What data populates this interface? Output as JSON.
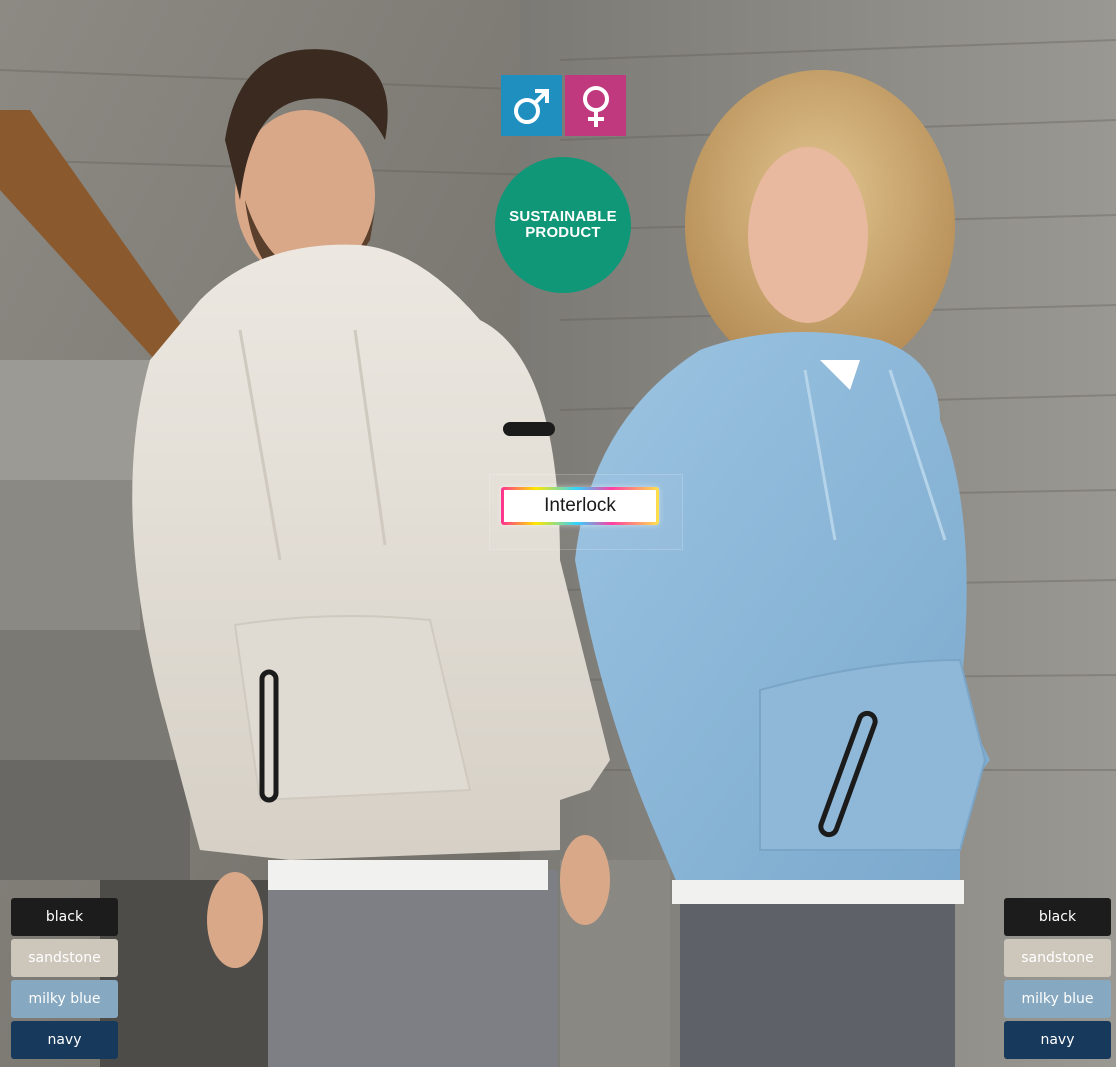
{
  "badges": {
    "male_icon": "male-symbol-icon",
    "female_icon": "female-symbol-icon",
    "sustainable_line1": "SUSTAINABLE",
    "sustainable_line2": "PRODUCT",
    "interlock_label": "Interlock"
  },
  "colors": {
    "male": "#1f8fbf",
    "female": "#c0387e",
    "sustainable": "#0f9777"
  },
  "swatches_left": [
    {
      "label": "black",
      "color": "#1c1c1c",
      "text_color": "#ffffff"
    },
    {
      "label": "sandstone",
      "color": "#cdc6bb",
      "text_color": "#ffffff"
    },
    {
      "label": "milky blue",
      "color": "#86a8c0",
      "text_color": "#ffffff"
    },
    {
      "label": "navy",
      "color": "#173a5c",
      "text_color": "#ffffff"
    }
  ],
  "swatches_right": [
    {
      "label": "black",
      "color": "#1c1c1c",
      "text_color": "#ffffff"
    },
    {
      "label": "sandstone",
      "color": "#cdc6bb",
      "text_color": "#ffffff"
    },
    {
      "label": "milky blue",
      "color": "#86a8c0",
      "text_color": "#ffffff"
    },
    {
      "label": "navy",
      "color": "#173a5c",
      "text_color": "#ffffff"
    }
  ]
}
